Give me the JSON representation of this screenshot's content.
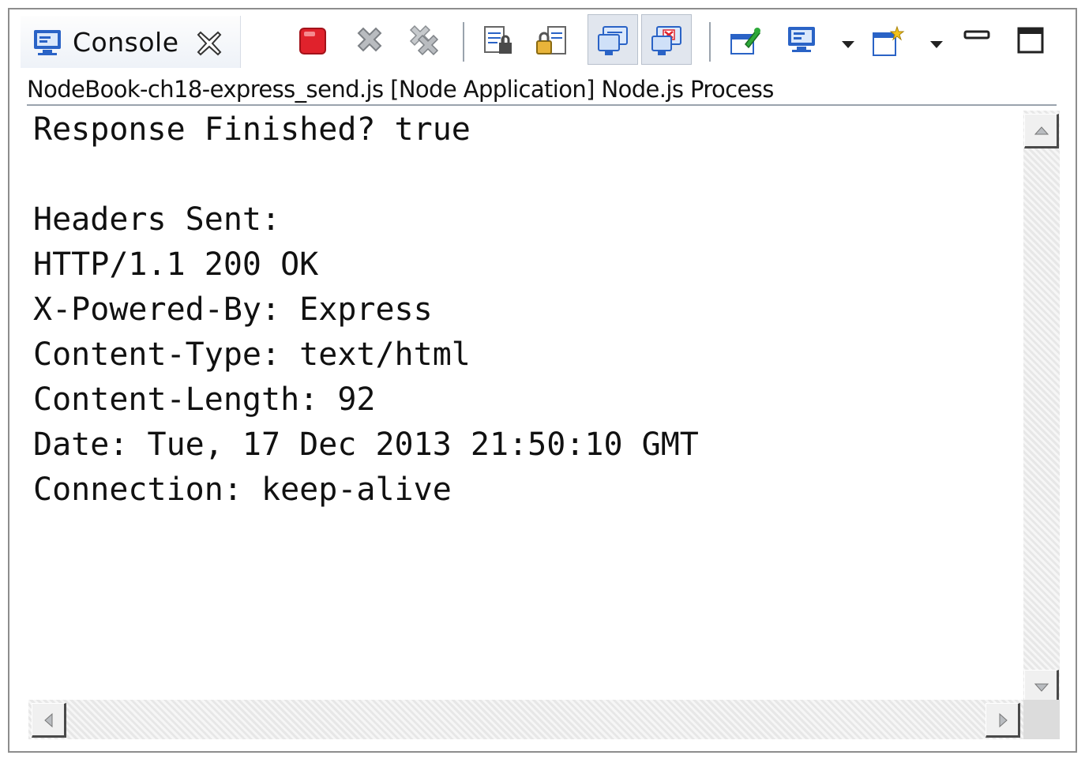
{
  "tab": {
    "label": "Console"
  },
  "process_title": "NodeBook-ch18-express_send.js [Node Application] Node.js Process",
  "console_lines": [
    "Response Finished? true",
    "",
    "Headers Sent:",
    "HTTP/1.1 200 OK",
    "X-Powered-By: Express",
    "Content-Type: text/html",
    "Content-Length: 92",
    "Date: Tue, 17 Dec 2013 21:50:10 GMT",
    "Connection: keep-alive"
  ],
  "colors": {
    "terminate": "#e0222c",
    "accent_blue": "#2a63c6",
    "text": "#111111"
  },
  "toolbar_icons": [
    "console-view-icon",
    "close-icon",
    "terminate-icon",
    "remove-launch-icon",
    "remove-all-terminated-icon",
    "scroll-lock-icon",
    "word-wrap-icon",
    "show-console-on-stdout-icon",
    "show-console-on-stderr-icon",
    "pin-console-icon",
    "display-selected-console-icon",
    "open-console-icon",
    "minimize-icon",
    "maximize-icon"
  ]
}
